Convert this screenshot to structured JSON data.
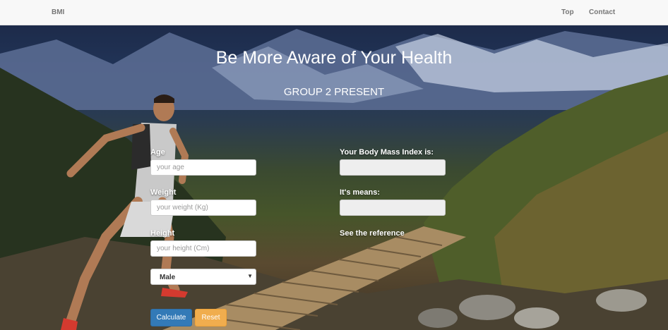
{
  "navbar": {
    "brand": "BMI",
    "links": [
      "Top",
      "Contact"
    ]
  },
  "hero": {
    "title": "Be More Aware of Your Health",
    "subtitle": "GROUP 2 PRESENT"
  },
  "form": {
    "age": {
      "label": "Age",
      "placeholder": "your age",
      "value": ""
    },
    "weight": {
      "label": "Weight",
      "placeholder": "your weight (Kg)",
      "value": ""
    },
    "height": {
      "label": "Height",
      "placeholder": "your height (Cm)",
      "value": ""
    },
    "gender": {
      "selected": "Male"
    },
    "calculate_label": "Calculate",
    "reset_label": "Reset"
  },
  "results": {
    "bmi_label": "Your Body Mass Index is:",
    "bmi_value": "",
    "meaning_label": "It's means:",
    "meaning_value": "",
    "reference_text": "See the reference"
  },
  "colors": {
    "primary": "#337ab7",
    "warning": "#f0ad4e",
    "navbar_bg": "#f8f8f8"
  }
}
